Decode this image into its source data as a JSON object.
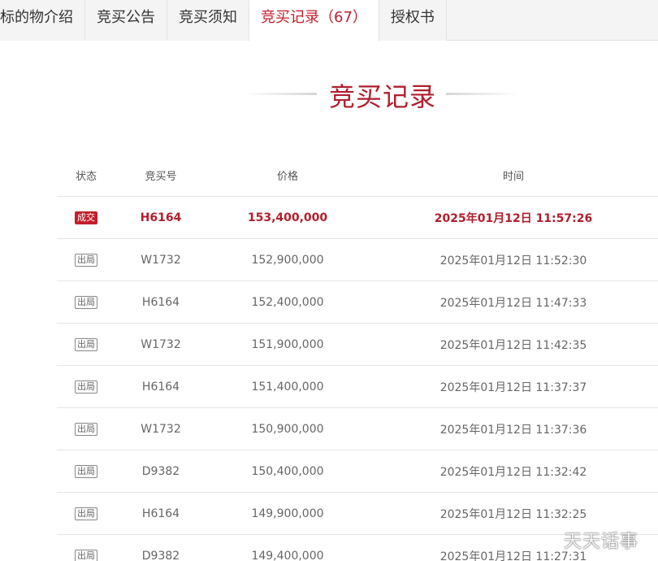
{
  "tabs": [
    {
      "label": "标的物介绍"
    },
    {
      "label": "竞买公告"
    },
    {
      "label": "竞买须知"
    },
    {
      "label": "竞买记录（67）"
    },
    {
      "label": "授权书"
    }
  ],
  "section": {
    "title": "竞买记录"
  },
  "table": {
    "headers": {
      "status": "状态",
      "bid_no": "竞买号",
      "price": "价格",
      "time": "时间"
    },
    "rows": [
      {
        "status": "成交",
        "bid_no": "H6164",
        "price": "153,400,000",
        "time": "2025年01月12日 11:57:26"
      },
      {
        "status": "出局",
        "bid_no": "W1732",
        "price": "152,900,000",
        "time": "2025年01月12日 11:52:30"
      },
      {
        "status": "出局",
        "bid_no": "H6164",
        "price": "152,400,000",
        "time": "2025年01月12日 11:47:33"
      },
      {
        "status": "出局",
        "bid_no": "W1732",
        "price": "151,900,000",
        "time": "2025年01月12日 11:42:35"
      },
      {
        "status": "出局",
        "bid_no": "H6164",
        "price": "151,400,000",
        "time": "2025年01月12日 11:37:37"
      },
      {
        "status": "出局",
        "bid_no": "W1732",
        "price": "150,900,000",
        "time": "2025年01月12日 11:37:36"
      },
      {
        "status": "出局",
        "bid_no": "D9382",
        "price": "150,400,000",
        "time": "2025年01月12日 11:32:42"
      },
      {
        "status": "出局",
        "bid_no": "H6164",
        "price": "149,900,000",
        "time": "2025年01月12日 11:32:25"
      },
      {
        "status": "出局",
        "bid_no": "D9382",
        "price": "149,400,000",
        "time": "2025年01月12日 11:27:31"
      }
    ]
  },
  "watermark": "天天话事",
  "colors": {
    "accent": "#b01e2e",
    "badge_win": "#c01f2c"
  }
}
